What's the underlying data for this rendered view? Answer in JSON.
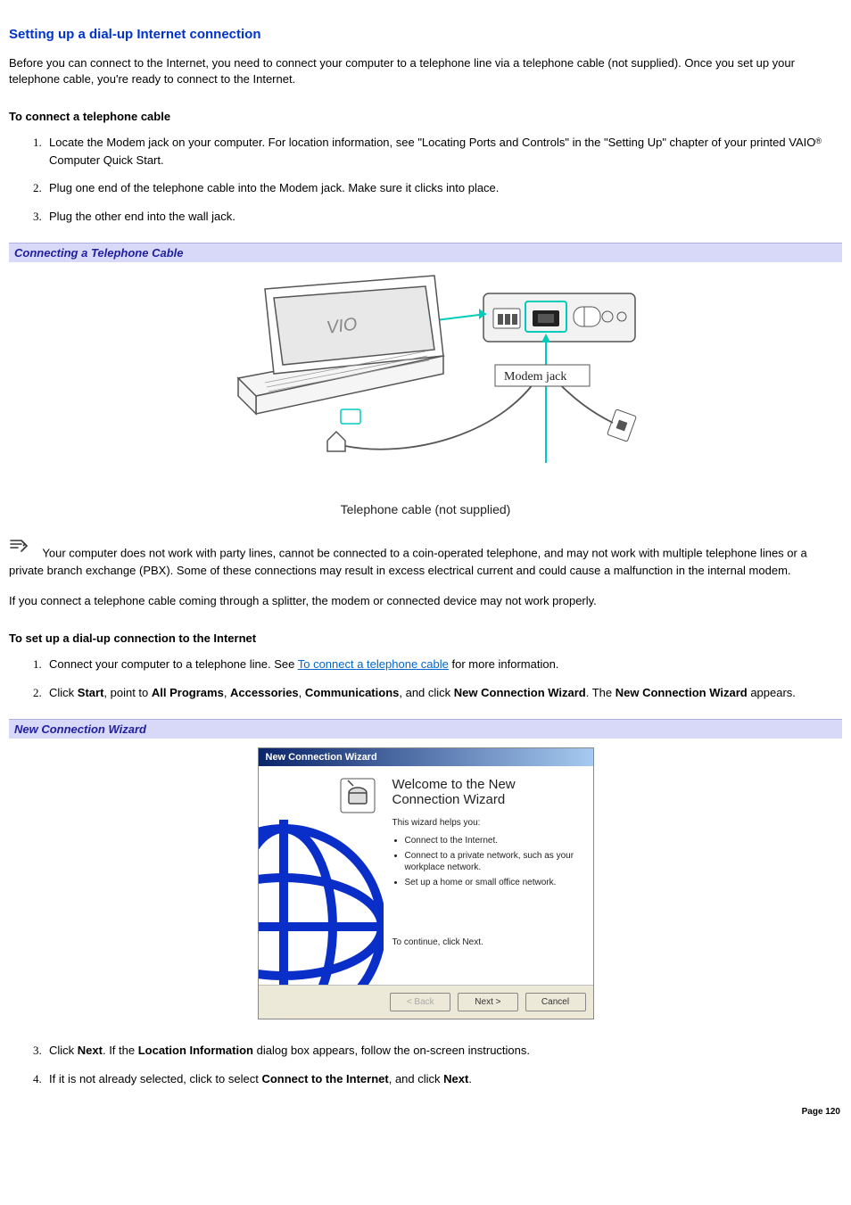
{
  "title": "Setting up a dial-up Internet connection",
  "intro": "Before you can connect to the Internet, you need to connect your computer to a telephone line via a telephone cable (not supplied). Once you set up your telephone cable, you're ready to connect to the Internet.",
  "section1_heading": "To connect a telephone cable",
  "section1_steps": {
    "s1a": "Locate the Modem jack on your computer. For location information, see \"Locating Ports and Controls\" in the \"Setting Up\" chapter of your printed VAIO",
    "s1b": " Computer Quick Start.",
    "s2": "Plug one end of the telephone cable into the Modem jack. Make sure it clicks into place.",
    "s3": "Plug the other end into the wall jack."
  },
  "figure1_caption": "Connecting a Telephone Cable",
  "figure1_modem_label": "Modem jack",
  "figure1_below": "Telephone cable (not supplied)",
  "note_text": " Your computer does not work with party lines, cannot be connected to a coin-operated telephone, and may not work with multiple telephone lines or a private branch exchange (PBX). Some of these connections may result in excess electrical current and could cause a malfunction in the internal modem.",
  "splitter_text": "If you connect a telephone cable coming through a splitter, the modem or connected device may not work properly.",
  "section2_heading": "To set up a dial-up connection to the Internet",
  "section2_steps": {
    "s1a": "Connect your computer to a telephone line. See ",
    "s1_link": "To connect a telephone cable",
    "s1b": " for more information.",
    "s2a": "Click ",
    "s2_start": "Start",
    "s2b": ", point to ",
    "s2_allprograms": "All Programs",
    "s2c": ", ",
    "s2_accessories": "Accessories",
    "s2d": ", ",
    "s2_comm": "Communications",
    "s2e": ", and click ",
    "s2_ncw": "New Connection Wizard",
    "s2f": ". The ",
    "s2_ncw2": "New Connection Wizard",
    "s2g": " appears.",
    "s3a": "Click ",
    "s3_next": "Next",
    "s3b": ". If the ",
    "s3_loc": "Location Information",
    "s3c": " dialog box appears, follow the on-screen instructions.",
    "s4a": "If it is not already selected, click to select ",
    "s4_connect": "Connect to the Internet",
    "s4b": ", and click ",
    "s4_next": "Next",
    "s4c": "."
  },
  "figure2_caption": "New Connection Wizard",
  "wizard": {
    "titlebar": "New Connection Wizard",
    "welcome": "Welcome to the New Connection Wizard",
    "helps": "This wizard helps you:",
    "bullets": {
      "b1": "Connect to the Internet.",
      "b2": "Connect to a private network, such as your workplace network.",
      "b3": "Set up a home or small office network."
    },
    "continue": "To continue, click Next.",
    "back": "< Back",
    "next": "Next >",
    "cancel": "Cancel"
  },
  "page_number": "Page 120"
}
